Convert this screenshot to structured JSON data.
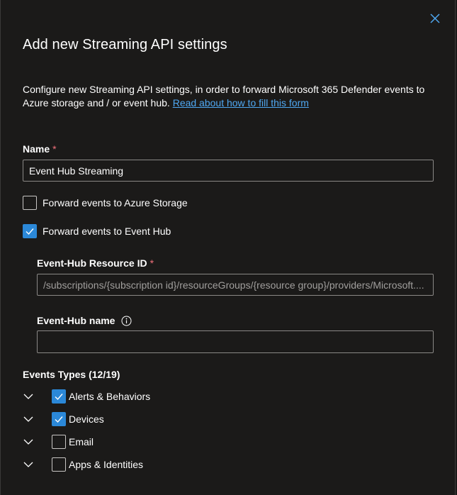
{
  "panel": {
    "title": "Add new Streaming API settings",
    "description": "Configure new Streaming API settings, in order to forward Microsoft 365 Defender events to Azure storage and / or event hub.",
    "read_more_link": "Read about how to fill this form"
  },
  "name_field": {
    "label": "Name",
    "required_marker": "*",
    "value": "Event Hub Streaming"
  },
  "forward_storage": {
    "label": "Forward events to Azure Storage",
    "checked": false
  },
  "forward_eventhub": {
    "label": "Forward events to Event Hub",
    "checked": true
  },
  "eventhub_resource": {
    "label": "Event-Hub Resource ID",
    "required_marker": "*",
    "placeholder": "/subscriptions/{subscription id}/resourceGroups/{resource group}/providers/Microsoft...."
  },
  "eventhub_name": {
    "label": "Event-Hub name",
    "value": ""
  },
  "event_types": {
    "heading": "Events Types (12/19)",
    "items": [
      {
        "label": "Alerts & Behaviors",
        "checked": true
      },
      {
        "label": "Devices",
        "checked": true
      },
      {
        "label": "Email",
        "checked": false
      },
      {
        "label": "Apps & Identities",
        "checked": false
      }
    ]
  },
  "colors": {
    "accent": "#2b88d8",
    "link": "#4fa8f2",
    "required": "#f1707b",
    "background": "#1b1a19"
  },
  "icons": [
    "close-icon",
    "checkmark-icon",
    "info-icon",
    "chevron-down-icon"
  ]
}
